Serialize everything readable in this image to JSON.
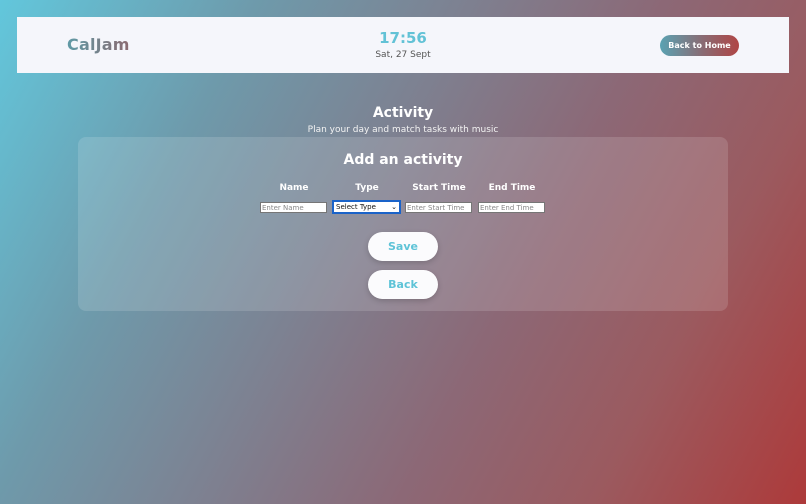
{
  "header": {
    "logo": "CalJam",
    "time": "17:56",
    "date": "Sat, 27 Sept",
    "home_button": "Back to Home"
  },
  "page": {
    "title": "Activity",
    "subtitle": "Plan your day and match tasks with music"
  },
  "form": {
    "title": "Add an activity",
    "columns": {
      "name": "Name",
      "type": "Type",
      "start": "Start Time",
      "end": "End Time"
    },
    "name_placeholder": "Enter Name",
    "type_selected": "Select Type",
    "start_placeholder": "Enter Start Time",
    "end_placeholder": "Enter End Time",
    "save_label": "Save",
    "back_label": "Back"
  },
  "colors": {
    "accent": "#62c2d6",
    "header_bg": "#f5f6fb",
    "gradient_start": "#62c7dc",
    "gradient_end": "#ad3a3a"
  }
}
